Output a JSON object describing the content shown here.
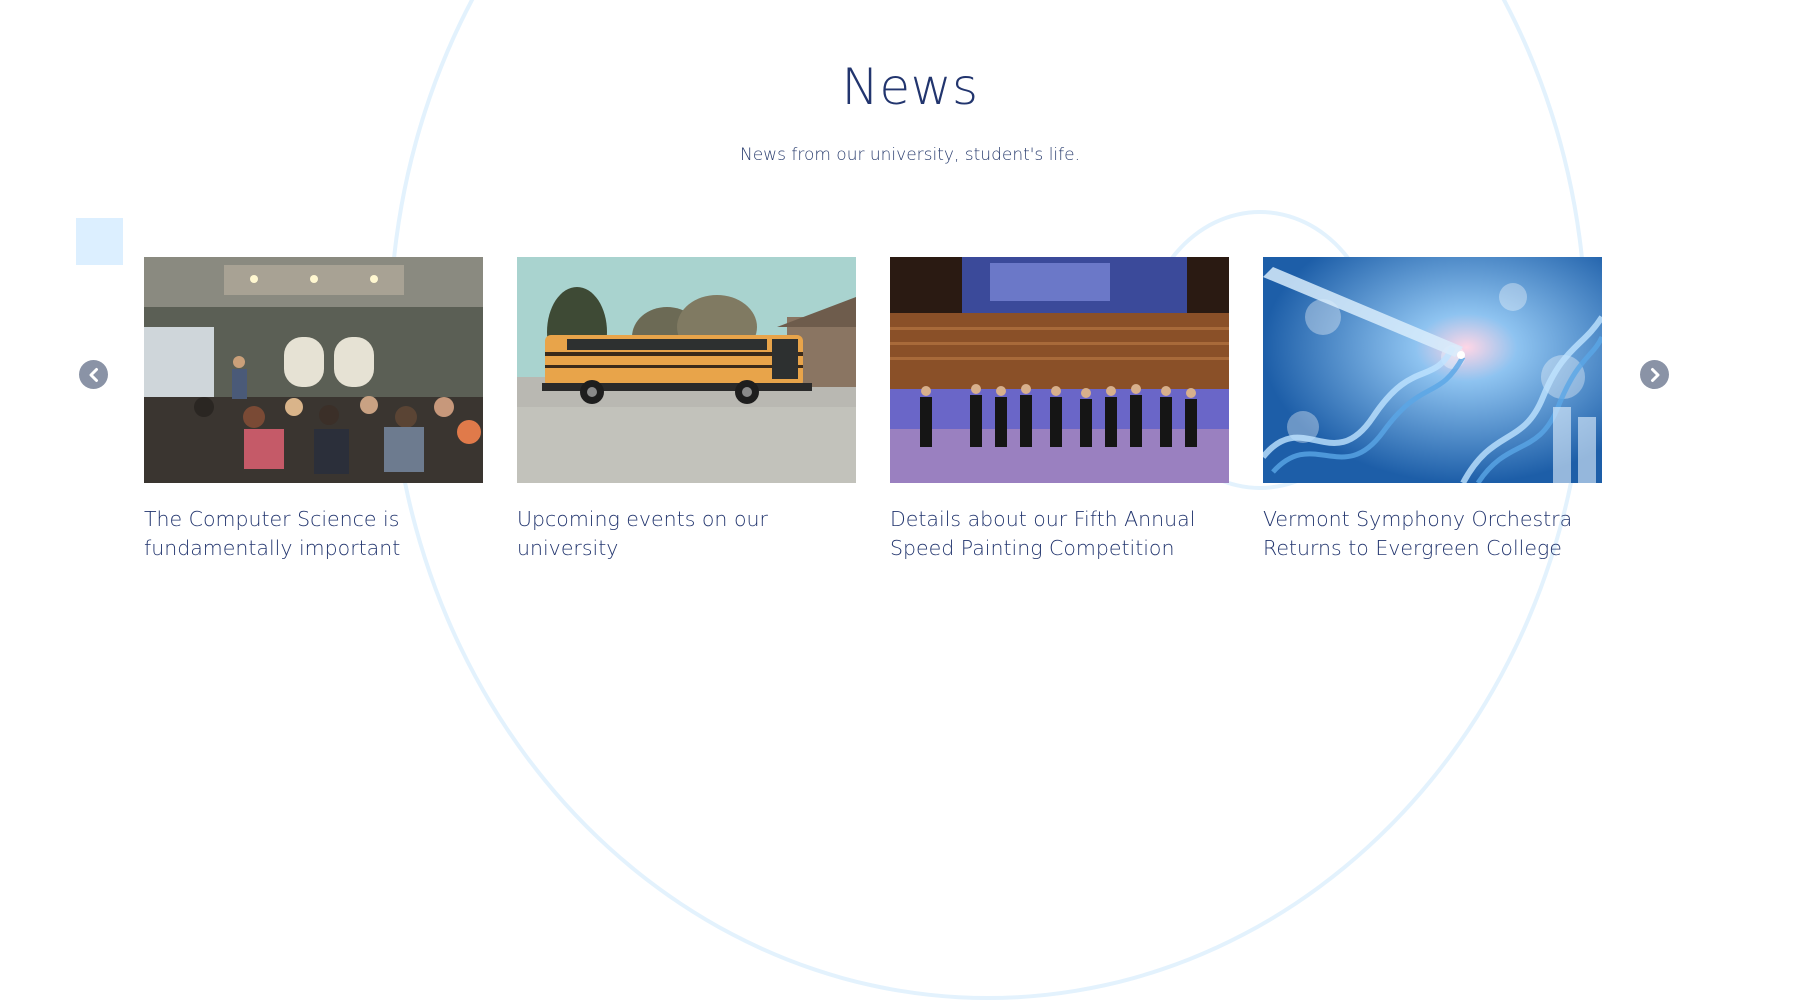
{
  "section": {
    "title": "News",
    "subtitle": "News from our university, student's life."
  },
  "carousel": {
    "prev_icon": "chevron-left-icon",
    "next_icon": "chevron-right-icon",
    "items": [
      {
        "title": "The Computer Science is fundamentally important",
        "image": "lecture-room-photo"
      },
      {
        "title": "Upcoming events on our university",
        "image": "school-bus-photo"
      },
      {
        "title": "Details about our Fifth Annual Speed Painting Competition",
        "image": "stage-performers-photo"
      },
      {
        "title": "Vermont Symphony Orchestra Returns to Evergreen College",
        "image": "dna-lab-photo"
      }
    ]
  },
  "colors": {
    "heading": "#22356e",
    "arrow": "#8a93a6",
    "accent_light": "#dcefff"
  }
}
